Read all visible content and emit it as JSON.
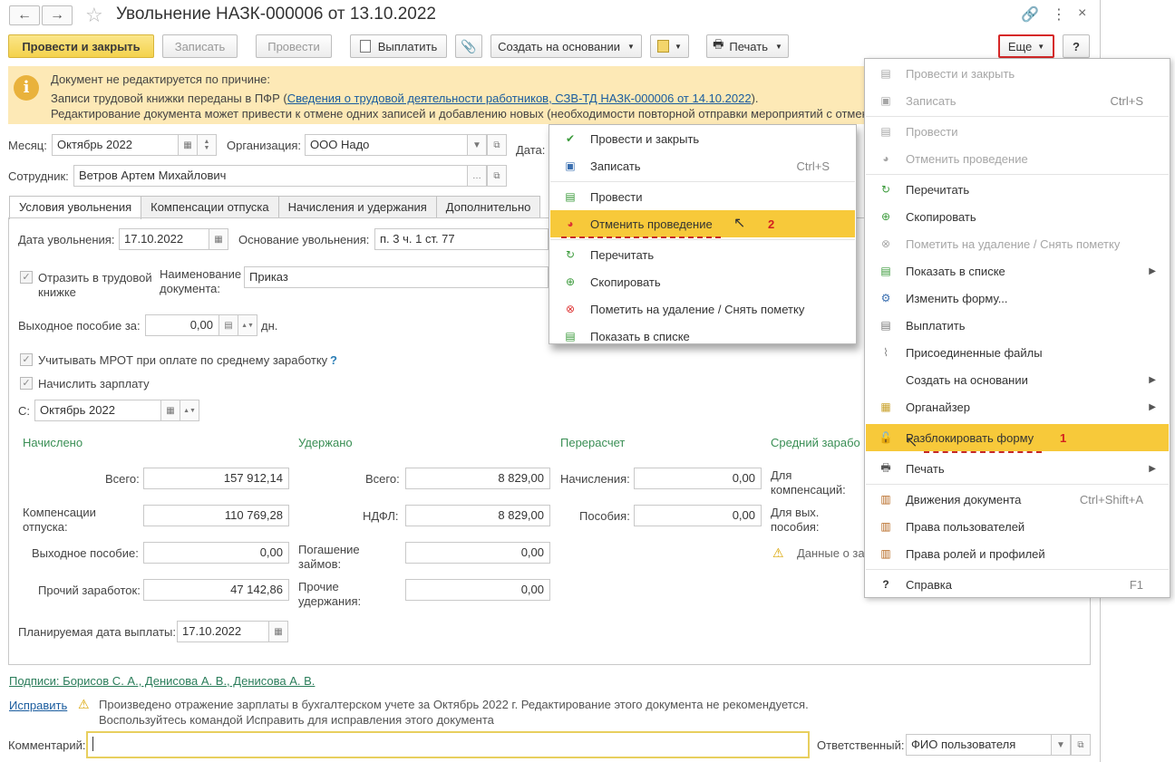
{
  "window": {
    "title": "Увольнение НАЗК-000006 от 13.10.2022",
    "nav_back": "←",
    "nav_forward": "→"
  },
  "toolbar": {
    "post_close": "Провести и закрыть",
    "save": "Записать",
    "post": "Провести",
    "pay": "Выплатить",
    "create_based": "Создать на основании",
    "print": "Печать",
    "more": "Еще",
    "help": "?"
  },
  "banner": {
    "line1": "Документ не редактируется по причине:",
    "line2_prefix": "Записи трудовой книжки переданы в ПФР (",
    "line2_link": "Сведения о трудовой деятельности работников, СЗВ-ТД НАЗК-000006 от 14.10.2022",
    "line2_suffix": ").",
    "line3": "Редактирование документа может привести к отмене одних записей и добавлению новых (необходимости повторной отправки мероприятий с отмен"
  },
  "header": {
    "month_label": "Месяц:",
    "month_value": "Октябрь 2022",
    "org_label": "Организация:",
    "org_value": "ООО Надо",
    "date_label": "Дата:",
    "employee_label": "Сотрудник:",
    "employee_value": "Ветров Артем Михайлович"
  },
  "tabs": [
    "Условия увольнения",
    "Компенсации отпуска",
    "Начисления и удержания",
    "Дополнительно"
  ],
  "conditions": {
    "dismissal_date_label": "Дата увольнения:",
    "dismissal_date_value": "17.10.2022",
    "basis_label": "Основание увольнения:",
    "basis_value": "п. 3 ч. 1 ст. 77",
    "reflect_label_1": "Отразить в трудовой",
    "reflect_label_2": "книжке",
    "docname_label_1": "Наименование",
    "docname_label_2": "документа:",
    "docname_value": "Приказ",
    "severance_label": "Выходное пособие за:",
    "severance_value": "0,00",
    "severance_unit": "дн.",
    "mrot_label": "Учитывать МРОТ при оплате по среднему заработку",
    "mrot_help": "?",
    "accrue_label": "Начислить зарплату",
    "from_label": "С:",
    "from_value": "Октябрь 2022"
  },
  "totals": {
    "accrued_title": "Начислено",
    "withheld_title": "Удержано",
    "recalc_title": "Перерасчет",
    "avg_title": "Средний зарабо",
    "total_label": "Всего:",
    "total_value": "157 912,14",
    "comp_label_1": "Компенсации",
    "comp_label_2": "отпуска:",
    "comp_value": "110 769,28",
    "sev_label": "Выходное пособие:",
    "sev_value": "0,00",
    "other_label": "Прочий заработок:",
    "other_value": "47 142,86",
    "w_total_label": "Всего:",
    "w_total_value": "8 829,00",
    "ndfl_label": "НДФЛ:",
    "ndfl_value": "8 829,00",
    "loans_label_1": "Погашение",
    "loans_label_2": "займов:",
    "loans_value": "0,00",
    "other_w_label_1": "Прочие",
    "other_w_label_2": "удержания:",
    "other_w_value": "0,00",
    "r_accr_label": "Начисления:",
    "r_accr_value": "0,00",
    "r_ben_label": "Пособия:",
    "r_ben_value": "0,00",
    "avg_comp_label_1": "Для",
    "avg_comp_label_2": "компенсаций:",
    "avg_sev_label_1": "Для вых.",
    "avg_sev_label_2": "пособия:",
    "avg_warning": "Данные о за",
    "payday_label": "Планируемая дата выплаты:",
    "payday_value": "17.10.2022"
  },
  "footer": {
    "signatures": "Подписи: Борисов С. А., Денисова А. В., Денисова А. В.",
    "fix_link": "Исправить",
    "fix_text_1": "Произведено отражение зарплаты в бухгалтерском учете за Октябрь 2022 г. Редактирование этого документа не рекомендуется.",
    "fix_text_2": "Воспользуйтесь командой Исправить для исправления этого документа",
    "comment_label": "Комментарий:",
    "responsible_label": "Ответственный:",
    "responsible_value": "ФИО пользователя"
  },
  "more_menu": {
    "items": [
      {
        "label": "Провести и закрыть",
        "shortcut": ""
      },
      {
        "label": "Записать",
        "shortcut": "Ctrl+S"
      },
      {
        "label": "Провести",
        "shortcut": ""
      },
      {
        "label": "Отменить проведение",
        "shortcut": ""
      },
      {
        "label": "Перечитать",
        "shortcut": ""
      },
      {
        "label": "Скопировать",
        "shortcut": ""
      },
      {
        "label": "Пометить на удаление / Снять пометку",
        "shortcut": ""
      },
      {
        "label": "Показать в списке",
        "shortcut": ""
      },
      {
        "label": "Изменить форму...",
        "shortcut": ""
      },
      {
        "label": "Выплатить",
        "shortcut": ""
      },
      {
        "label": "Присоединенные файлы",
        "shortcut": ""
      },
      {
        "label": "Создать на основании",
        "shortcut": ""
      },
      {
        "label": "Органайзер",
        "shortcut": ""
      },
      {
        "label": "Разблокировать форму",
        "shortcut": ""
      },
      {
        "label": "Печать",
        "shortcut": ""
      },
      {
        "label": "Движения документа",
        "shortcut": "Ctrl+Shift+A"
      },
      {
        "label": "Права пользователей",
        "shortcut": ""
      },
      {
        "label": "Права ролей и профилей",
        "shortcut": ""
      },
      {
        "label": "Справка",
        "shortcut": "F1"
      }
    ],
    "marker": "1"
  },
  "zoom_menu": {
    "items": [
      {
        "label": "Провести и закрыть",
        "shortcut": ""
      },
      {
        "label": "Записать",
        "shortcut": "Ctrl+S"
      },
      {
        "label": "Провести",
        "shortcut": ""
      },
      {
        "label": "Отменить проведение",
        "shortcut": ""
      },
      {
        "label": "Перечитать",
        "shortcut": ""
      },
      {
        "label": "Скопировать",
        "shortcut": ""
      },
      {
        "label": "Пометить на удаление / Снять пометку",
        "shortcut": ""
      },
      {
        "label": "Показать в списке",
        "shortcut": ""
      }
    ],
    "marker": "2"
  },
  "colors": {
    "highlight": "#f7c93a",
    "banner": "#fde9b6",
    "accent_green": "#3a8f55",
    "red_marker": "#d32020"
  }
}
